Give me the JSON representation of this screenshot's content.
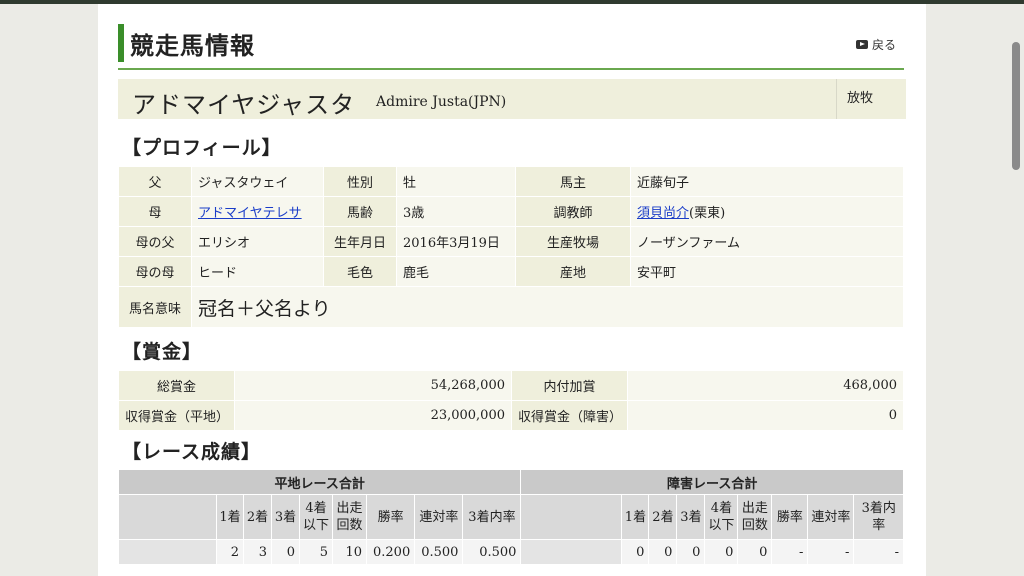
{
  "header": {
    "title": "競走馬情報",
    "back_label": "戻る"
  },
  "horse": {
    "name_jp": "アドマイヤジャスタ",
    "name_en": "Admire Justa(JPN)",
    "status": "放牧"
  },
  "profile": {
    "heading": "【プロフィール】",
    "rows": [
      [
        {
          "label": "父",
          "value": "ジャスタウェイ"
        },
        {
          "label": "性別",
          "value": "牡"
        },
        {
          "label": "馬主",
          "value": "近藤旬子"
        }
      ],
      [
        {
          "label": "母",
          "value": "アドマイヤテレサ",
          "link": true
        },
        {
          "label": "馬齢",
          "value": "3歳"
        },
        {
          "label": "調教師",
          "value": "須貝尚介",
          "suffix": "(栗東)",
          "link": true
        }
      ],
      [
        {
          "label": "母の父",
          "value": "エリシオ"
        },
        {
          "label": "生年月日",
          "value": "2016年3月19日"
        },
        {
          "label": "生産牧場",
          "value": "ノーザンファーム"
        }
      ],
      [
        {
          "label": "母の母",
          "value": "ヒード"
        },
        {
          "label": "毛色",
          "value": "鹿毛"
        },
        {
          "label": "産地",
          "value": "安平町"
        }
      ]
    ],
    "meaning_label": "馬名意味",
    "meaning_value": "冠名＋父名より"
  },
  "prize": {
    "heading": "【賞金】",
    "rows": [
      [
        {
          "label": "総賞金",
          "value": "54,268,000"
        },
        {
          "label": "内付加賞",
          "value": "468,000"
        }
      ],
      [
        {
          "label": "収得賞金（平地）",
          "value": "23,000,000"
        },
        {
          "label": "収得賞金（障害）",
          "value": "0"
        }
      ]
    ]
  },
  "race": {
    "heading": "【レース成績】",
    "flat_title": "平地レース合計",
    "jump_title": "障害レース合計",
    "columns": [
      "1着",
      "2着",
      "3着",
      "4着以下",
      "出走回数",
      "勝率",
      "連対率",
      "3着内率"
    ],
    "flat": [
      "2",
      "3",
      "0",
      "5",
      "10",
      "0.200",
      "0.500",
      "0.500"
    ],
    "jump": [
      "0",
      "0",
      "0",
      "0",
      "0",
      "-",
      "-",
      "-"
    ]
  }
}
